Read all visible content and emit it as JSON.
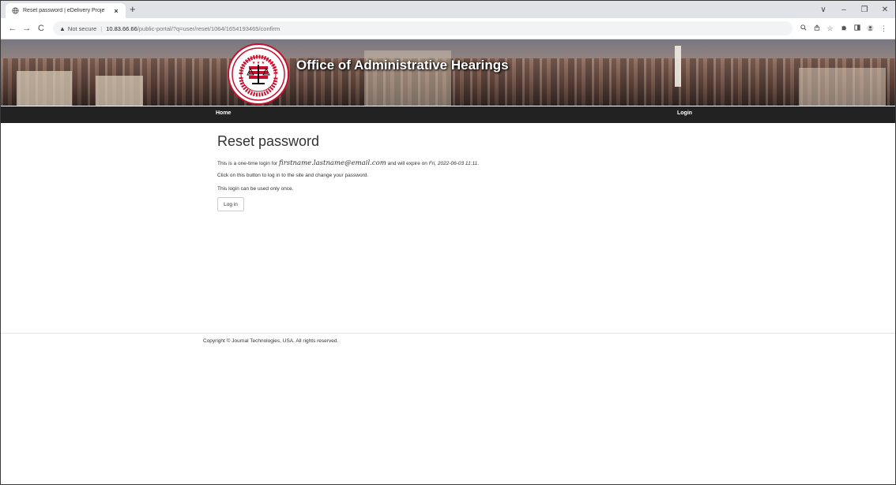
{
  "browser": {
    "tab_title": "Reset password | eDelivery Proje",
    "tab_close": "×",
    "new_tab": "+",
    "window_controls": [
      "∨",
      "–",
      "❐",
      "✕"
    ],
    "nav": {
      "back": "←",
      "forward": "→",
      "reload": "C"
    },
    "security_label": "Not secure",
    "url_host": "10.83.66.66",
    "url_path": "/public-portal/?q=user/reset/1064/1654193465/confirm"
  },
  "banner": {
    "title": "Office of Administrative Hearings",
    "seal_text": "DISTRICT OF COLUMBIA • OFFICE OF ADMINISTRATIVE HEARINGS"
  },
  "navbar": {
    "home": "Home",
    "login": "Login"
  },
  "main": {
    "heading": "Reset password",
    "line1_prefix": "This is a one-time login for",
    "line1_email": "firstname.lastname@email.com",
    "line1_mid": "and will expire on",
    "line1_date": "Fri, 2022-06-03 11:11",
    "line1_end": ".",
    "line2": "Click on this button to log in to the site and change your password.",
    "line3": "This login can be used only once.",
    "button_label": "Log in"
  },
  "footer": {
    "copyright": "Copyright © Journal Technologies, USA. All rights reserved."
  },
  "colors": {
    "navbar": "#222222",
    "seal_red": "#c8102e",
    "chrome": "#dfe3e8"
  }
}
